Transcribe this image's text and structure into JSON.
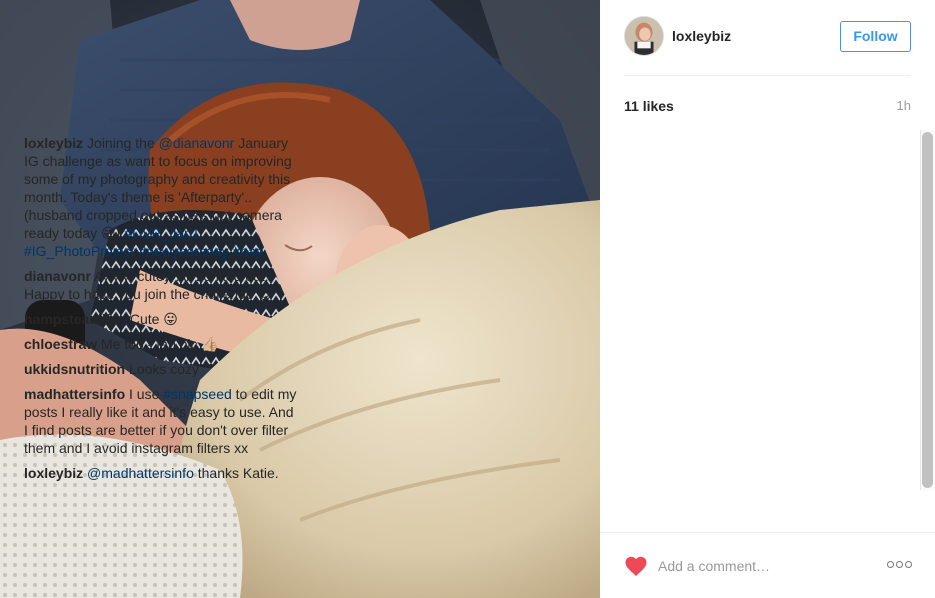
{
  "post": {
    "username": "loxleybiz",
    "follow_label": "Follow",
    "likes": "11 likes",
    "time": "1h"
  },
  "comments": [
    {
      "author": "loxleybiz",
      "parts": [
        {
          "t": "text",
          "v": " Joining the "
        },
        {
          "t": "link",
          "v": "@dianavonr"
        },
        {
          "t": "text",
          "v": " January IG challenge as want to focus on improving some of my photography and creativity this month. Today's theme is 'Afterparty'.. (husband cropped out as he's not camera ready today 😁) "
        },
        {
          "t": "link",
          "v": "#DVR_Jan1"
        },
        {
          "t": "text",
          "v": " "
        },
        {
          "t": "link",
          "v": "#IG_PhotoProject"
        },
        {
          "t": "text",
          "v": " "
        },
        {
          "t": "link",
          "v": "#newyearsday"
        },
        {
          "t": "text",
          "v": " "
        },
        {
          "t": "link",
          "v": "#nap"
        }
      ]
    },
    {
      "author": "dianavonr",
      "parts": [
        {
          "t": "text",
          "v": " Awww cutey. All zonked out. Happy to have you join the challenge 😍"
        }
      ],
      "deletable": true
    },
    {
      "author": "hampsteadlife_",
      "parts": [
        {
          "t": "text",
          "v": " Cute 😛"
        }
      ]
    },
    {
      "author": "chloestraw",
      "parts": [
        {
          "t": "text",
          "v": " Me too - fab pic 👍🏼"
        }
      ]
    },
    {
      "author": "ukkidsnutrition",
      "parts": [
        {
          "t": "text",
          "v": " Looks cozy"
        }
      ]
    },
    {
      "author": "madhattersinfo",
      "parts": [
        {
          "t": "text",
          "v": " I use "
        },
        {
          "t": "link",
          "v": "#snapseed"
        },
        {
          "t": "text",
          "v": " to edit my posts I really like it and it's easy to use. And I find posts are better if you don't over filter them and I avoid instagram filters xx"
        }
      ]
    },
    {
      "author": "loxleybiz",
      "parts": [
        {
          "t": "text",
          "v": " "
        },
        {
          "t": "link",
          "v": "@madhattersinfo"
        },
        {
          "t": "text",
          "v": " thanks Katie."
        }
      ]
    }
  ],
  "delete_glyph": "×",
  "footer": {
    "comment_placeholder": "Add a comment…"
  },
  "icons": {
    "like": "heart-icon",
    "more": "more-options-icon",
    "delete": "delete-comment-icon"
  },
  "colors": {
    "link": "#003569",
    "follow": "#3897f0",
    "heart": "#ed4956"
  }
}
